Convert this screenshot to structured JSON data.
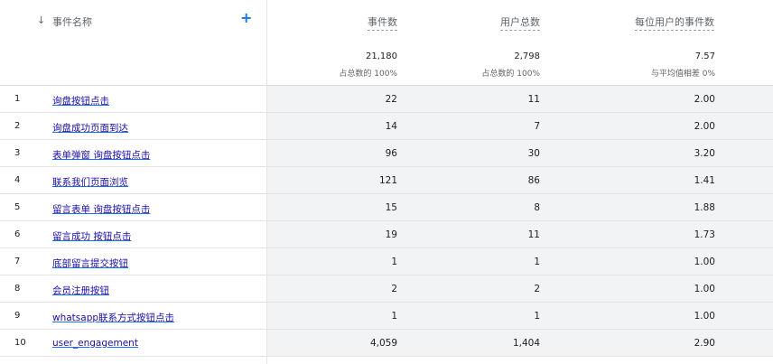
{
  "header": {
    "event_name_label": "事件名称",
    "sort_icon": "arrow-down-icon",
    "add_icon": "plus-icon",
    "add_symbol": "+",
    "sort_symbol": "↓",
    "col_event_count": "事件数",
    "col_total_users": "用户总数",
    "col_per_user": "每位用户的事件数"
  },
  "totals": {
    "event_count": "21,180",
    "event_count_sub": "占总数的 100%",
    "total_users": "2,798",
    "total_users_sub": "占总数的 100%",
    "per_user": "7.57",
    "per_user_sub": "与平均值相差 0%"
  },
  "rows": [
    {
      "idx": "1",
      "name": "询盘按钮点击",
      "events": "22",
      "users": "11",
      "per_user": "2.00"
    },
    {
      "idx": "2",
      "name": "询盘成功页面到达",
      "events": "14",
      "users": "7",
      "per_user": "2.00"
    },
    {
      "idx": "3",
      "name": "表单弹窗 询盘按钮点击",
      "events": "96",
      "users": "30",
      "per_user": "3.20"
    },
    {
      "idx": "4",
      "name": "联系我们页面浏览",
      "events": "121",
      "users": "86",
      "per_user": "1.41"
    },
    {
      "idx": "5",
      "name": "留言表单 询盘按钮点击",
      "events": "15",
      "users": "8",
      "per_user": "1.88"
    },
    {
      "idx": "6",
      "name": "留言成功 按钮点击",
      "events": "19",
      "users": "11",
      "per_user": "1.73"
    },
    {
      "idx": "7",
      "name": "底部留言提交按钮",
      "events": "1",
      "users": "1",
      "per_user": "1.00"
    },
    {
      "idx": "8",
      "name": "会员注册按钮",
      "events": "2",
      "users": "2",
      "per_user": "1.00"
    },
    {
      "idx": "9",
      "name": "whatsapp联系方式按钮点击",
      "events": "1",
      "users": "1",
      "per_user": "1.00"
    },
    {
      "idx": "10",
      "name": "user_engagement",
      "events": "4,059",
      "users": "1,404",
      "per_user": "2.90"
    }
  ]
}
